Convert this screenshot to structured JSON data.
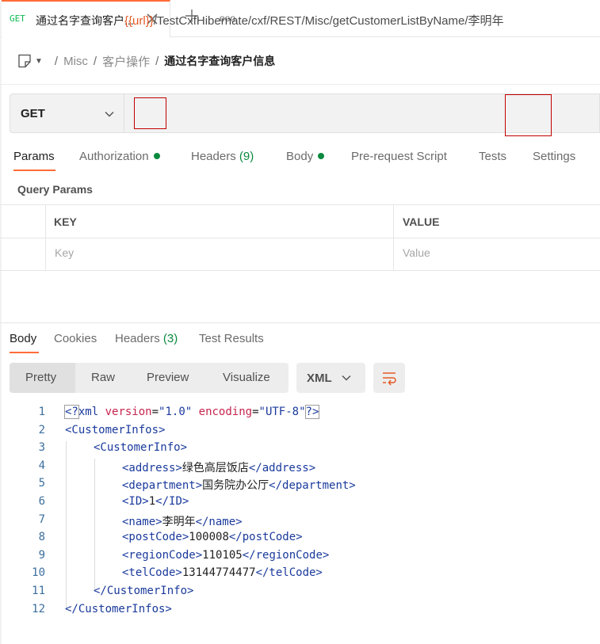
{
  "tab": {
    "method": "GET",
    "title": "通过名字查询客户..."
  },
  "tabbar": {
    "more": "ooo"
  },
  "breadcrumb": {
    "folder": "Misc",
    "sub": "客户操作",
    "current": "通过名字查询客户信息"
  },
  "request": {
    "method": "GET",
    "url_var": "{{url}}",
    "url_path": "/TestCxfHibernate/cxf/REST/Misc/getCustomerListByName/",
    "url_param": "李明年"
  },
  "request_tabs": {
    "params": "Params",
    "authorization": "Authorization",
    "headers": "Headers",
    "headers_count": "(9)",
    "body": "Body",
    "prerequest": "Pre-request Script",
    "tests": "Tests",
    "settings": "Settings"
  },
  "query_params": {
    "title": "Query Params",
    "col_key": "KEY",
    "col_value": "VALUE",
    "key_placeholder": "Key",
    "value_placeholder": "Value"
  },
  "response_tabs": {
    "body": "Body",
    "cookies": "Cookies",
    "headers": "Headers",
    "headers_count": "(3)",
    "test_results": "Test Results"
  },
  "format": {
    "options": [
      "Pretty",
      "Raw",
      "Preview",
      "Visualize"
    ],
    "selected": "Pretty",
    "language": "XML"
  },
  "colors": {
    "accent": "#ff6c37",
    "get": "#0cbb52",
    "dot": "#0b8a3f",
    "highlight_box": "#c00000"
  },
  "code": {
    "line_numbers": [
      "1",
      "2",
      "3",
      "4",
      "5",
      "6",
      "7",
      "8",
      "9",
      "10",
      "11",
      "12"
    ],
    "decl": {
      "open": "<?",
      "name": "xml",
      "a1": "version",
      "v1": "\"1.0\"",
      "a2": "encoding",
      "v2": "\"UTF-8\"",
      "close": "?>"
    },
    "root_tag": "CustomerInfos",
    "item_tag": "CustomerInfo",
    "fields": [
      {
        "tag": "address",
        "value": "绿色高层饭店"
      },
      {
        "tag": "department",
        "value": "国务院办公厅"
      },
      {
        "tag": "ID",
        "value": "1"
      },
      {
        "tag": "name",
        "value": "李明年"
      },
      {
        "tag": "postCode",
        "value": "100008"
      },
      {
        "tag": "regionCode",
        "value": "110105"
      },
      {
        "tag": "telCode",
        "value": "13144774477"
      }
    ]
  }
}
